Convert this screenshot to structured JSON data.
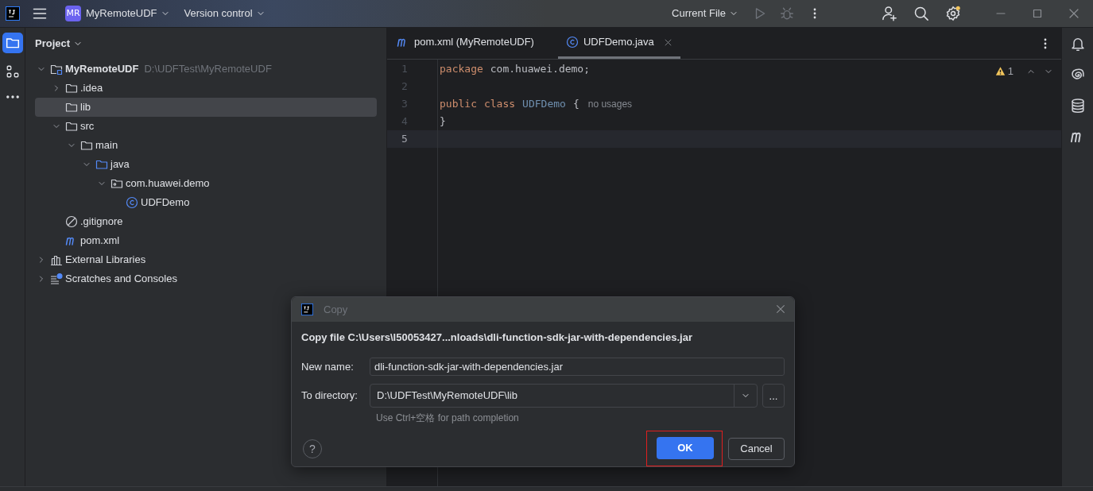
{
  "title_bar": {
    "project_badge": "MR",
    "project": "MyRemoteUDF",
    "vcs": "Version control",
    "run_config": "Current File"
  },
  "project_panel": {
    "title": "Project",
    "tree": [
      {
        "label": "MyRemoteUDF",
        "hint": "D:\\UDFTest\\MyRemoteUDF",
        "kind": "module",
        "expanded": true,
        "selected": false,
        "children": [
          {
            "label": ".idea",
            "kind": "folder",
            "expanded": false,
            "selected": false
          },
          {
            "label": "lib",
            "kind": "folder",
            "selected": true
          },
          {
            "label": "src",
            "kind": "folder",
            "expanded": true,
            "selected": false,
            "children": [
              {
                "label": "main",
                "kind": "folder",
                "expanded": true,
                "selected": false,
                "children": [
                  {
                    "label": "java",
                    "kind": "source",
                    "expanded": true,
                    "selected": false,
                    "children": [
                      {
                        "label": "com.huawei.demo",
                        "kind": "package",
                        "expanded": true,
                        "selected": false,
                        "children": [
                          {
                            "label": "UDFDemo",
                            "kind": "class",
                            "selected": false
                          }
                        ]
                      }
                    ]
                  }
                ]
              }
            ]
          },
          {
            "label": ".gitignore",
            "kind": "ignore",
            "selected": false
          },
          {
            "label": "pom.xml",
            "kind": "maven",
            "selected": false
          }
        ]
      },
      {
        "label": "External Libraries",
        "kind": "libraries",
        "expanded": false,
        "selected": false
      },
      {
        "label": "Scratches and Consoles",
        "kind": "scratches",
        "expanded": false,
        "selected": false
      }
    ]
  },
  "editor": {
    "tabs": [
      {
        "label": "pom.xml (MyRemoteUDF)",
        "kind": "maven",
        "selected": false
      },
      {
        "label": "UDFDemo.java",
        "kind": "class",
        "selected": true
      }
    ],
    "warnings": "1",
    "lines": [
      {
        "number": "1",
        "current": false,
        "tokens": [
          {
            "kind": "keyword",
            "text": "package"
          },
          {
            "kind": "plain",
            "text": "com.huawei.demo;"
          }
        ]
      },
      {
        "number": "2",
        "current": false
      },
      {
        "number": "3",
        "current": false,
        "tokens": [
          {
            "kind": "keyword",
            "text": "public"
          },
          {
            "kind": "keyword",
            "text": "class"
          },
          {
            "kind": "classname",
            "text": "UDFDemo"
          },
          {
            "kind": "plain",
            "text": "{"
          },
          {
            "kind": "hint",
            "text": "no usages"
          }
        ]
      },
      {
        "number": "4",
        "current": false,
        "tokens": [
          {
            "kind": "plain",
            "text": "}"
          }
        ]
      },
      {
        "number": "5",
        "current": true
      }
    ]
  },
  "dialog": {
    "title": "Copy",
    "heading": "Copy file C:\\Users\\l50053427...nloads\\dli-function-sdk-jar-with-dependencies.jar",
    "new_name_label": "New name:",
    "new_name": "dli-function-sdk-jar-with-dependencies.jar",
    "directory_label": "To directory:",
    "directory": "D:\\UDFTest\\MyRemoteUDF\\lib",
    "browse": "...",
    "note": "Use Ctrl+空格 for path completion",
    "help": "?",
    "ok": "OK",
    "cancel": "Cancel"
  }
}
